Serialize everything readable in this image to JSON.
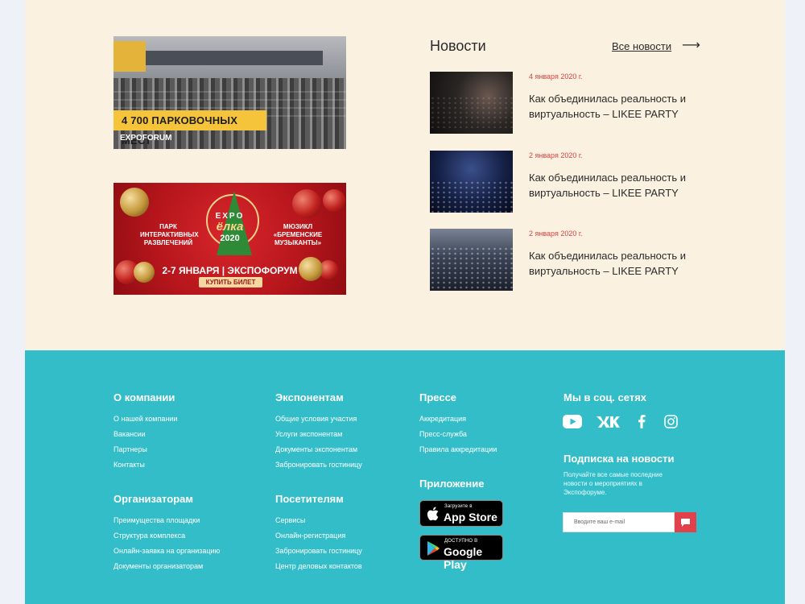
{
  "banners": {
    "parking": {
      "tag": "4 700 ПАРКОВОЧНЫХ МЕСТ",
      "logo": "EXPOFORUM"
    },
    "promo": {
      "expo": "EXPO",
      "elka": "ёлка",
      "year": "2020",
      "left_text": "ПАРК ИНТЕРАКТИВНЫХ РАЗВЛЕЧЕНИЙ",
      "right_text": "МЮЗИКЛ «БРЕМЕНСКИЕ МУЗЫКАНТЫ»",
      "dates": "2-7 ЯНВАРЯ | ЭКСПОФОРУМ",
      "button": "КУПИТЬ БИЛЕТ"
    }
  },
  "news": {
    "title": "Новости",
    "all_label": "Все новости",
    "items": [
      {
        "date": "4 января 2020 г.",
        "text": "Как объединилась реальность и виртуальность – LIKEE PARTY"
      },
      {
        "date": "2 января 2020 г.",
        "text": "Как объединилась реальность и виртуальность – LIKEE PARTY"
      },
      {
        "date": "2 января 2020 г.",
        "text": "Как объединилась реальность и виртуальность – LIKEE PARTY"
      }
    ]
  },
  "footer": {
    "company": {
      "title": "О компании",
      "links": [
        "О нашей компании",
        "Вакансии",
        "Партнеры",
        "Контакты"
      ]
    },
    "exhibitors": {
      "title": "Экспонентам",
      "links": [
        "Общие условия участия",
        "Услуги экспонентам",
        "Документы экспонентам",
        "Забронировать гостиницу"
      ]
    },
    "press": {
      "title": "Прессе",
      "links": [
        "Аккредитация",
        "Пресс-служба",
        "Правила аккредитации"
      ]
    },
    "organizers": {
      "title": "Организаторам",
      "links": [
        "Преимущества площадки",
        "Структура комплекса",
        "Онлайн-заявка на организацию",
        "Документы организаторам"
      ]
    },
    "visitors": {
      "title": "Посетителям",
      "links": [
        "Сервисы",
        "Онлайн-регистрация",
        "Забронировать гостиницу",
        "Центр деловых контактов"
      ]
    },
    "app": {
      "title": "Приложение",
      "appstore_small": "Загрузите в",
      "appstore_big": "App Store",
      "googleplay_small": "ДОСТУПНО В",
      "googleplay_big": "Google Play"
    },
    "social": {
      "title": "Мы в соц. сетях",
      "icons": [
        "youtube-icon",
        "vk-icon",
        "facebook-icon",
        "instagram-icon"
      ]
    },
    "subscribe": {
      "title": "Подписка на новости",
      "description": "Получайте все самые последние новости о мероприятиях в Экспофоруме.",
      "placeholder": "Вводите ваш e-mail"
    }
  },
  "colors": {
    "footer_bg": "#32bdc9",
    "top_bg": "#fbf1e1",
    "accent": "#e0414b",
    "date": "#e0413f"
  }
}
